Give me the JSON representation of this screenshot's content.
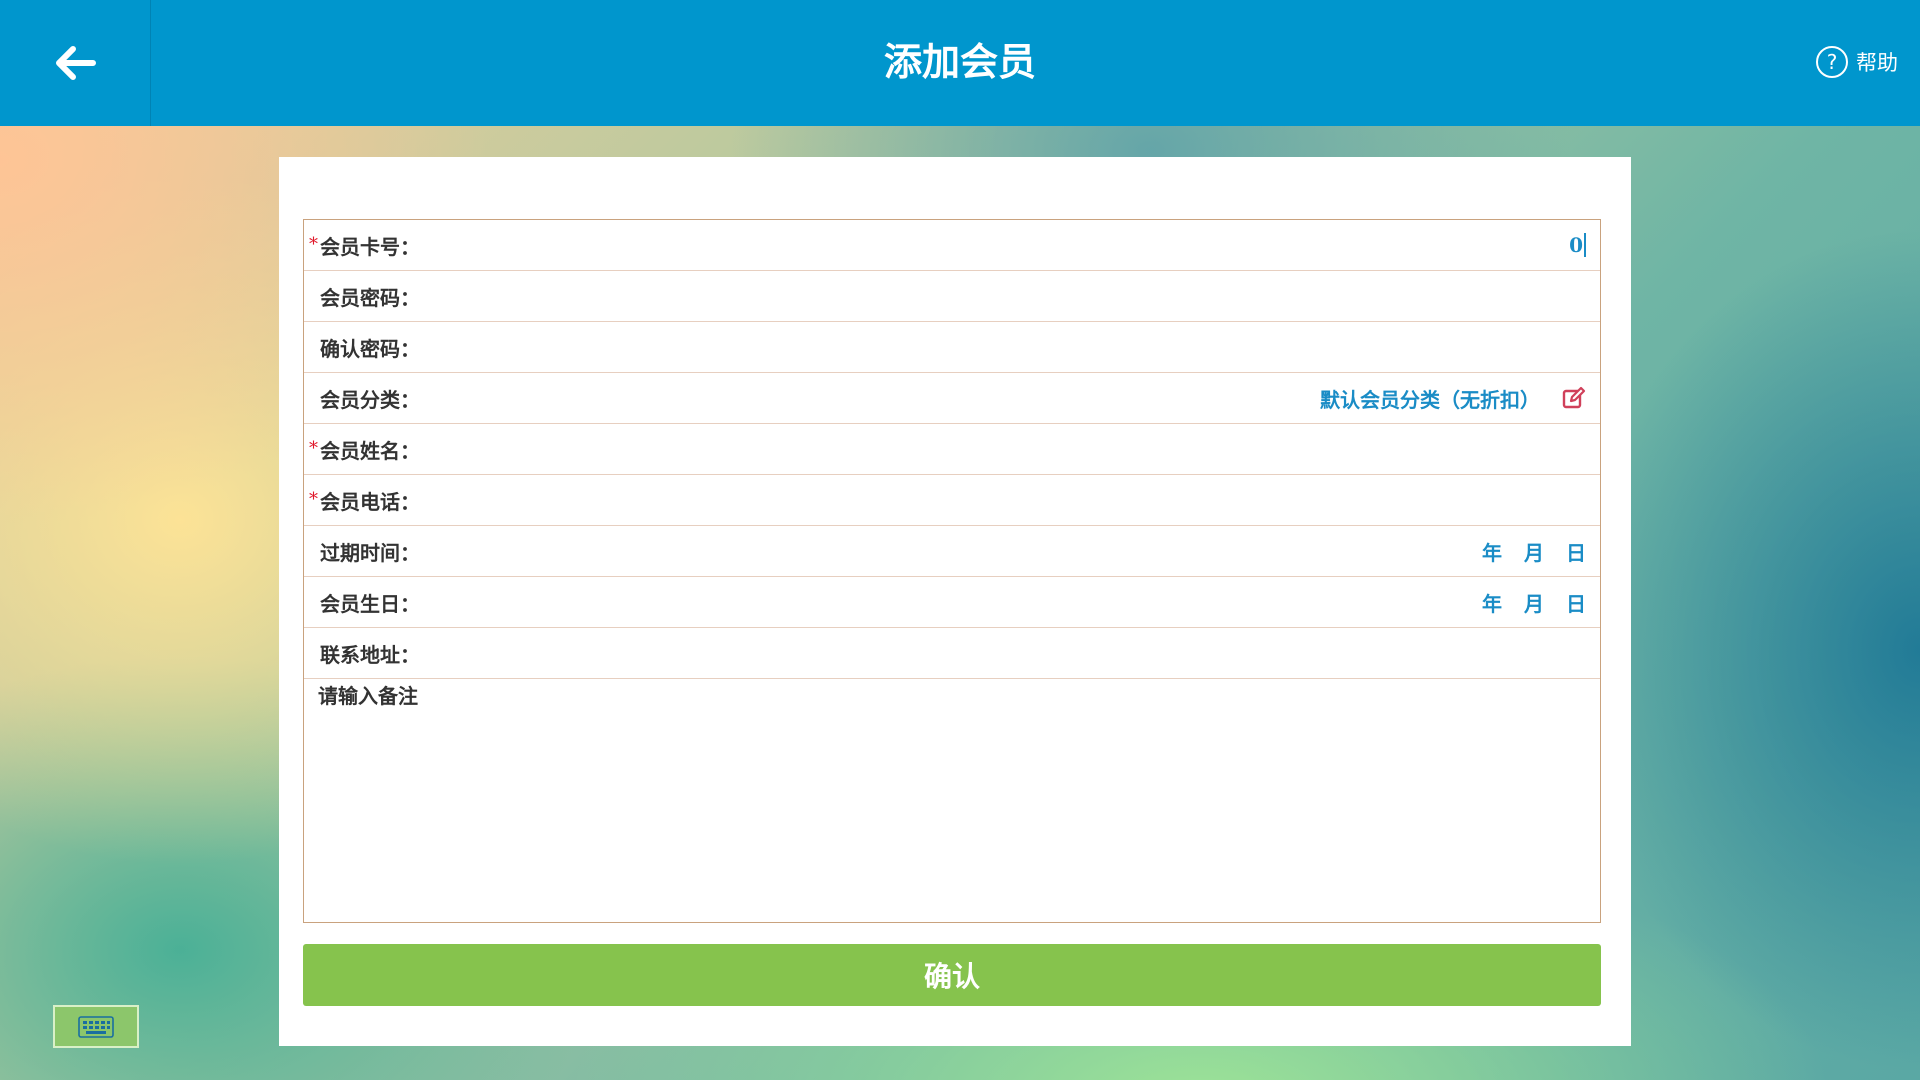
{
  "header": {
    "title": "添加会员",
    "help_label": "帮助"
  },
  "form": {
    "fields": [
      {
        "label": "会员卡号：",
        "required": true,
        "value": "0"
      },
      {
        "label": "会员密码：",
        "required": false,
        "value": ""
      },
      {
        "label": "确认密码：",
        "required": false,
        "value": ""
      },
      {
        "label": "会员分类：",
        "required": false,
        "value": "默认会员分类（无折扣）"
      },
      {
        "label": "会员姓名：",
        "required": true,
        "value": ""
      },
      {
        "label": "会员电话：",
        "required": true,
        "value": ""
      },
      {
        "label": "过期时间：",
        "required": false,
        "date": [
          "年",
          "月",
          "日"
        ]
      },
      {
        "label": "会员生日：",
        "required": false,
        "date": [
          "年",
          "月",
          "日"
        ]
      },
      {
        "label": "联系地址：",
        "required": false,
        "value": ""
      }
    ],
    "required_mark": "*",
    "remarks_placeholder": "请输入备注",
    "confirm_label": "确认"
  },
  "colors": {
    "header_bg": "#0096cd",
    "accent_value": "#1a8cc6",
    "confirm_bg": "#86c34d",
    "required_mark": "#e0182a",
    "edit_icon": "#d0405a"
  },
  "icons": {
    "back": "arrow-left-icon",
    "help": "question-circle-icon",
    "edit": "edit-icon",
    "keyboard": "keyboard-icon"
  }
}
